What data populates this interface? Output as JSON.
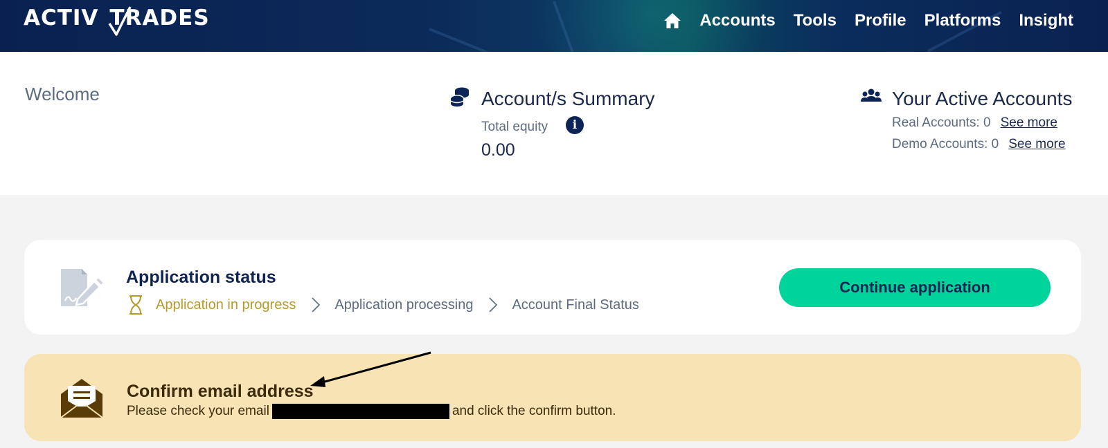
{
  "header": {
    "logo_text_left": "ACTIV",
    "logo_text_right": "TRADES",
    "home_icon": "home-icon",
    "nav": [
      "Accounts",
      "Tools",
      "Profile",
      "Platforms",
      "Insight"
    ]
  },
  "summary": {
    "welcome": "Welcome",
    "account_summary": {
      "icon": "coins-icon",
      "title": "Account/s Summary",
      "equity_label": "Total equity",
      "info_icon": "info-icon",
      "equity_value": "0.00"
    },
    "active_accounts": {
      "icon": "users-icon",
      "title": "Your Active Accounts",
      "real_label": "Real Accounts: 0",
      "demo_label": "Demo Accounts: 0",
      "see_more": "See more"
    }
  },
  "application": {
    "icon": "signed-document-icon",
    "title": "Application status",
    "steps": [
      "Application in progress",
      "Application processing",
      "Account Final Status"
    ],
    "continue_label": "Continue application"
  },
  "email_notice": {
    "icon": "open-envelope-icon",
    "title": "Confirm email address",
    "text_before": "Please check your email",
    "text_after": "and click the confirm button."
  },
  "colors": {
    "header_bg": "#0a2150",
    "cta_bg": "#00d49a",
    "notice_bg": "#f7e3b3",
    "in_progress": "#b49a2a"
  }
}
